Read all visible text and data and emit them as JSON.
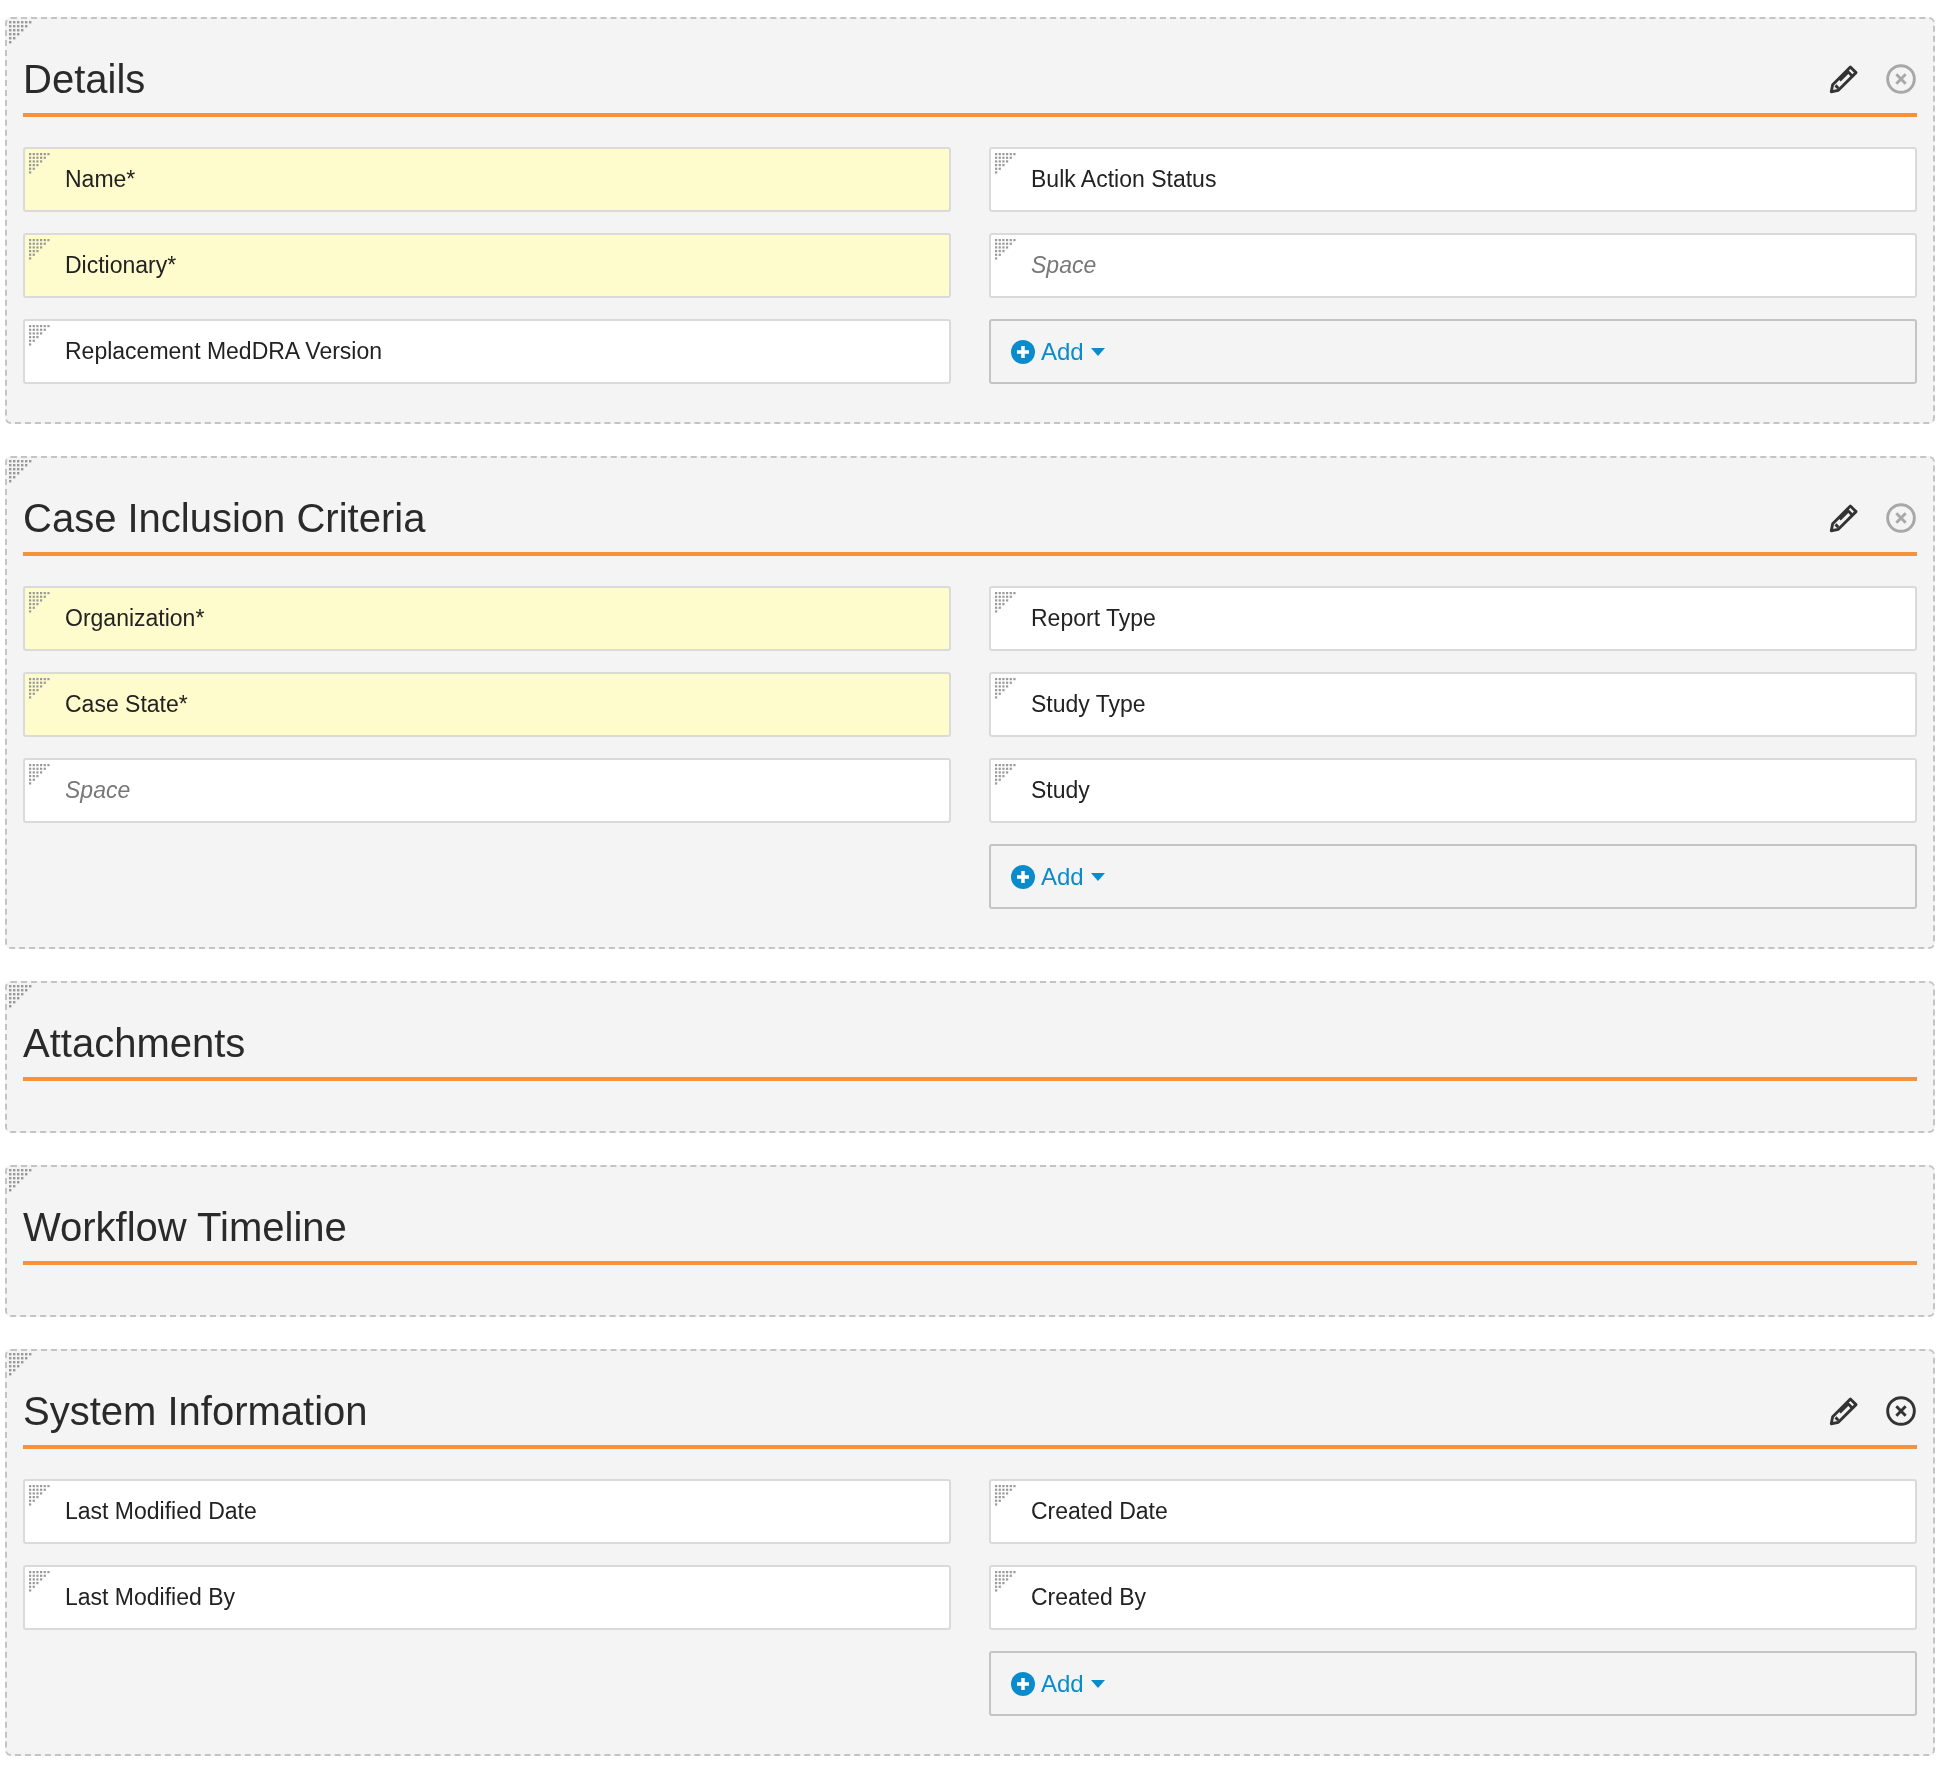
{
  "sections": [
    {
      "title": "Details",
      "actions": {
        "close_disabled": true
      },
      "left": [
        {
          "kind": "field",
          "label": "Name*",
          "required": true
        },
        {
          "kind": "field",
          "label": "Dictionary*",
          "required": true
        },
        {
          "kind": "field",
          "label": "Replacement MedDRA Version",
          "required": false
        }
      ],
      "right": [
        {
          "kind": "field",
          "label": "Bulk Action Status",
          "required": false
        },
        {
          "kind": "space",
          "label": "Space",
          "required": false
        },
        {
          "kind": "add",
          "label": "Add"
        }
      ]
    },
    {
      "title": "Case Inclusion Criteria",
      "actions": {
        "close_disabled": true
      },
      "left": [
        {
          "kind": "field",
          "label": "Organization*",
          "required": true
        },
        {
          "kind": "field",
          "label": "Case State*",
          "required": true
        },
        {
          "kind": "space",
          "label": "Space",
          "required": false
        }
      ],
      "right": [
        {
          "kind": "field",
          "label": "Report Type",
          "required": false
        },
        {
          "kind": "field",
          "label": "Study Type",
          "required": false
        },
        {
          "kind": "field",
          "label": "Study",
          "required": false
        },
        {
          "kind": "add",
          "label": "Add"
        }
      ]
    },
    {
      "title": "Attachments"
    },
    {
      "title": "Workflow Timeline"
    },
    {
      "title": "System Information",
      "actions": {
        "close_disabled": false
      },
      "left": [
        {
          "kind": "field",
          "label": "Last Modified Date",
          "required": false
        },
        {
          "kind": "field",
          "label": "Last Modified By",
          "required": false
        }
      ],
      "right": [
        {
          "kind": "field",
          "label": "Created Date",
          "required": false
        },
        {
          "kind": "field",
          "label": "Created By",
          "required": false
        },
        {
          "kind": "add",
          "label": "Add"
        }
      ]
    }
  ]
}
